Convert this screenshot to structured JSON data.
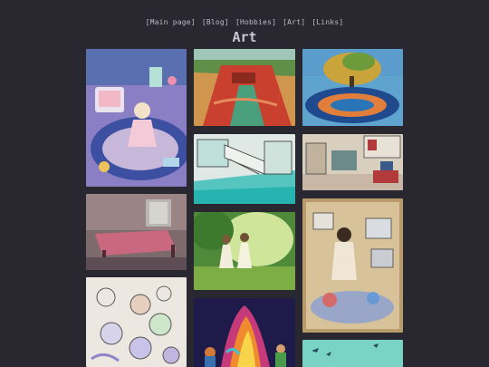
{
  "nav": {
    "items": [
      "[Main page]",
      "[Blog]",
      "[Hobbies]",
      "[Art]",
      "[Links]"
    ]
  },
  "page": {
    "title": "Art"
  },
  "gallery": {
    "artworks": [
      {
        "name": "artwork-girl-with-cat-tv"
      },
      {
        "name": "artwork-red-canyon-stream"
      },
      {
        "name": "artwork-tree-pond"
      },
      {
        "name": "artwork-pool-building"
      },
      {
        "name": "artwork-room-interior"
      },
      {
        "name": "artwork-bedroom"
      },
      {
        "name": "artwork-girls-in-forest"
      },
      {
        "name": "artwork-figures-with-tvs"
      },
      {
        "name": "artwork-sketchbook-faces"
      },
      {
        "name": "artwork-colorful-fire"
      },
      {
        "name": "artwork-teal-water"
      }
    ]
  }
}
